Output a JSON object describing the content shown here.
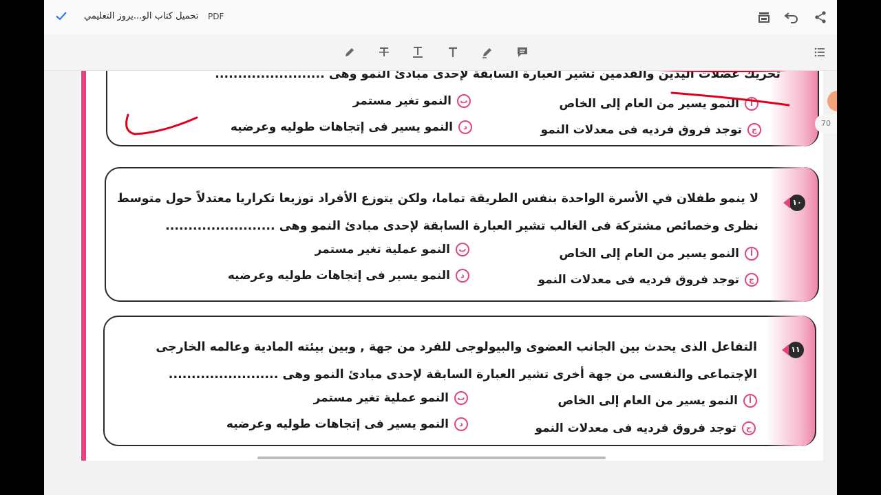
{
  "app": {
    "doc_title": "تحميل كتاب الو...يروز التعليمي",
    "doc_type": "PDF",
    "page_number": "70"
  },
  "icons": {
    "done": "check-icon",
    "layout": "page-layout-icon",
    "undo": "undo-icon",
    "share": "share-icon",
    "tools": [
      "pen-icon",
      "strikethrough-icon",
      "underline-icon",
      "text-icon",
      "highlighter-icon",
      "comment-icon"
    ],
    "list": "list-icon"
  },
  "colors": {
    "accent": "#e4437f",
    "ink": "#e0001b",
    "check": "#1a73e8"
  },
  "questions": [
    {
      "number": "",
      "lines": [
        "تحريك عضلات اليدين والقدمين تشير العبارة السابقة لإحدى مبادئ النمو وهى ........................"
      ],
      "options": [
        {
          "letter": "أ",
          "text": "النمو يسير من العام إلى الخاص"
        },
        {
          "letter": "ب",
          "text": "النمو تغير مستمر"
        },
        {
          "letter": "ج",
          "text": "توجد فروق فرديه فى معدلات النمو"
        },
        {
          "letter": "د",
          "text": "النمو يسير فى إتجاهات طوليه وعرضيه"
        }
      ]
    },
    {
      "number": "١٠",
      "lines": [
        "لا ينمو طفلان في الأسرة الواحدة بنفس الطريقة تماما، ولكن يتوزع الأفراد توزيعا تكراريا معتدلاً حول متوسط",
        "نظرى وخصائص مشتركة فى الغالب تشير العبارة السابقة لإحدى مبادئ النمو وهى ........................"
      ],
      "options": [
        {
          "letter": "أ",
          "text": "النمو يسير من العام إلى الخاص"
        },
        {
          "letter": "ب",
          "text": "النمو عملية تغير مستمر"
        },
        {
          "letter": "ج",
          "text": "توجد فروق فرديه فى معدلات النمو"
        },
        {
          "letter": "د",
          "text": "النمو يسير فى إتجاهات طوليه وعرضيه"
        }
      ]
    },
    {
      "number": "١١",
      "lines": [
        "التفاعل الذى يحدث بين الجانب العضوى والبيولوجى للفرد من جهة , وبين بيئته المادية وعالمه الخارجى",
        "الإجتماعى والنفسى من جهة أخرى  تشير العبارة السابقة لإحدى مبادئ النمو وهى ........................"
      ],
      "options": [
        {
          "letter": "أ",
          "text": "النمو يسير من العام إلى الخاص"
        },
        {
          "letter": "ب",
          "text": "النمو عملية تغير مستمر"
        },
        {
          "letter": "ج",
          "text": "توجد فروق فرديه فى معدلات النمو"
        },
        {
          "letter": "د",
          "text": "النمو يسير فى إتجاهات طوليه وعرضيه"
        }
      ]
    }
  ]
}
